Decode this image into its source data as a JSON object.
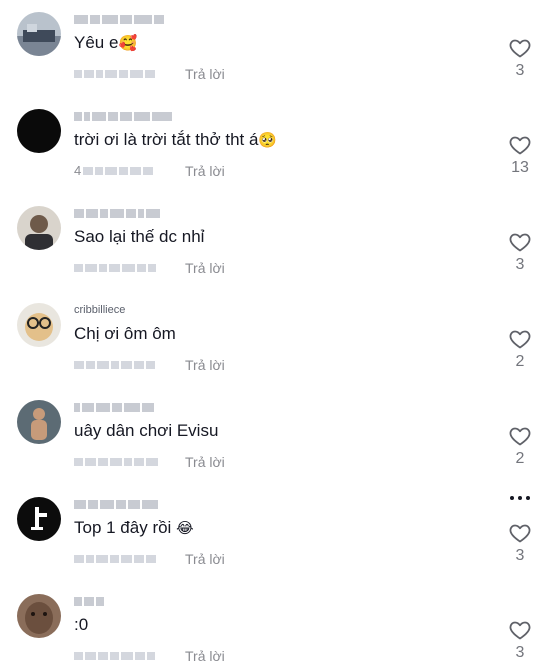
{
  "reply_label": "Trả lời",
  "comments": [
    {
      "username_visible": "",
      "text": "Yêu e",
      "emoji": "🥰",
      "likes": "3",
      "date_tail": ""
    },
    {
      "username_visible": "",
      "text": "trời ơi là trời tắt thở tht á",
      "emoji": "🥺",
      "likes": "13",
      "date_tail": "4"
    },
    {
      "username_visible": "",
      "text": "Sao lại thế dc nhỉ",
      "emoji": "",
      "likes": "3",
      "date_tail": ""
    },
    {
      "username_visible": "cribbilliece",
      "text": "Chị ơi ôm ôm",
      "emoji": "",
      "likes": "2",
      "date_tail": ""
    },
    {
      "username_visible": "",
      "text": "uây dân chơi Evisu",
      "emoji": "",
      "likes": "2",
      "date_tail": ""
    },
    {
      "username_visible": "",
      "text": "Top 1 đây rồi ",
      "emoji": "😂",
      "likes": "3",
      "date_tail": ""
    },
    {
      "username_visible": "",
      "text": ":0",
      "emoji": "",
      "likes": "3",
      "date_tail": ""
    }
  ],
  "colors": {
    "text": "#161823",
    "secondary": "#8a8b91",
    "count": "#73757c"
  },
  "icons": {
    "like": "heart-outline-icon",
    "more": "more-horizontal-icon"
  }
}
